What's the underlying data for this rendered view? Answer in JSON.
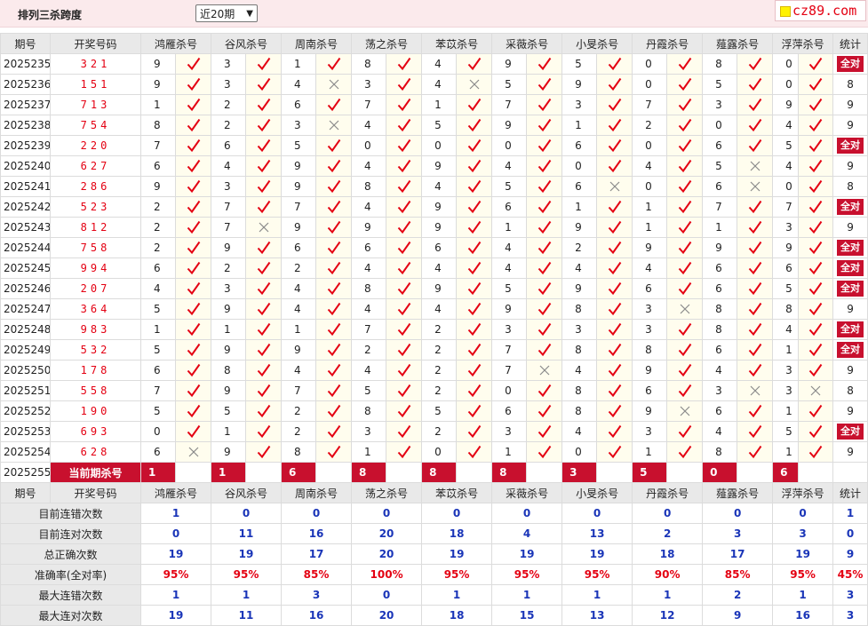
{
  "title": "排列三杀跨度",
  "select": {
    "value": "近20期"
  },
  "logo": {
    "text": "cz89.com"
  },
  "headers": [
    "期号",
    "开奖号码",
    "鸿雁杀号",
    "谷风杀号",
    "周南杀号",
    "荡之杀号",
    "苯苡杀号",
    "采薇杀号",
    "小旻杀号",
    "丹霞杀号",
    "薤露杀号",
    "浮萍杀号",
    "统计"
  ],
  "rows": [
    {
      "period": "2025235",
      "code": "321",
      "v": [
        9,
        3,
        1,
        8,
        4,
        9,
        5,
        0,
        8,
        0
      ],
      "ok": [
        1,
        1,
        1,
        1,
        1,
        1,
        1,
        1,
        1,
        1
      ],
      "total": "全对"
    },
    {
      "period": "2025236",
      "code": "151",
      "v": [
        9,
        3,
        4,
        3,
        4,
        5,
        9,
        0,
        5,
        0
      ],
      "ok": [
        1,
        1,
        0,
        1,
        0,
        1,
        1,
        1,
        1,
        1
      ],
      "total": "8"
    },
    {
      "period": "2025237",
      "code": "713",
      "v": [
        1,
        2,
        6,
        7,
        1,
        7,
        3,
        7,
        3,
        9
      ],
      "ok": [
        1,
        1,
        1,
        1,
        1,
        1,
        1,
        1,
        1,
        1
      ],
      "total": "9"
    },
    {
      "period": "2025238",
      "code": "754",
      "v": [
        8,
        2,
        3,
        4,
        5,
        9,
        1,
        2,
        0,
        4
      ],
      "ok": [
        1,
        1,
        0,
        1,
        1,
        1,
        1,
        1,
        1,
        1
      ],
      "total": "9"
    },
    {
      "period": "2025239",
      "code": "220",
      "v": [
        7,
        6,
        5,
        0,
        0,
        0,
        6,
        0,
        6,
        5
      ],
      "ok": [
        1,
        1,
        1,
        1,
        1,
        1,
        1,
        1,
        1,
        1
      ],
      "total": "全对"
    },
    {
      "period": "2025240",
      "code": "627",
      "v": [
        6,
        4,
        9,
        4,
        9,
        4,
        0,
        4,
        5,
        4
      ],
      "ok": [
        1,
        1,
        1,
        1,
        1,
        1,
        1,
        1,
        0,
        1
      ],
      "total": "9"
    },
    {
      "period": "2025241",
      "code": "286",
      "v": [
        9,
        3,
        9,
        8,
        4,
        5,
        6,
        0,
        6,
        0
      ],
      "ok": [
        1,
        1,
        1,
        1,
        1,
        1,
        0,
        1,
        0,
        1
      ],
      "total": "8"
    },
    {
      "period": "2025242",
      "code": "523",
      "v": [
        2,
        7,
        7,
        4,
        9,
        6,
        1,
        1,
        7,
        7
      ],
      "ok": [
        1,
        1,
        1,
        1,
        1,
        1,
        1,
        1,
        1,
        1
      ],
      "total": "全对"
    },
    {
      "period": "2025243",
      "code": "812",
      "v": [
        2,
        7,
        9,
        9,
        9,
        1,
        9,
        1,
        1,
        3
      ],
      "ok": [
        1,
        0,
        1,
        1,
        1,
        1,
        1,
        1,
        1,
        1
      ],
      "total": "9"
    },
    {
      "period": "2025244",
      "code": "758",
      "v": [
        2,
        9,
        6,
        6,
        6,
        4,
        2,
        9,
        9,
        9
      ],
      "ok": [
        1,
        1,
        1,
        1,
        1,
        1,
        1,
        1,
        1,
        1
      ],
      "total": "全对"
    },
    {
      "period": "2025245",
      "code": "994",
      "v": [
        6,
        2,
        2,
        4,
        4,
        4,
        4,
        4,
        6,
        6
      ],
      "ok": [
        1,
        1,
        1,
        1,
        1,
        1,
        1,
        1,
        1,
        1
      ],
      "total": "全对"
    },
    {
      "period": "2025246",
      "code": "207",
      "v": [
        4,
        3,
        4,
        8,
        9,
        5,
        9,
        6,
        6,
        5
      ],
      "ok": [
        1,
        1,
        1,
        1,
        1,
        1,
        1,
        1,
        1,
        1
      ],
      "total": "全对"
    },
    {
      "period": "2025247",
      "code": "364",
      "v": [
        5,
        9,
        4,
        4,
        4,
        9,
        8,
        3,
        8,
        8
      ],
      "ok": [
        1,
        1,
        1,
        1,
        1,
        1,
        1,
        0,
        1,
        1
      ],
      "total": "9"
    },
    {
      "period": "2025248",
      "code": "983",
      "v": [
        1,
        1,
        1,
        7,
        2,
        3,
        3,
        3,
        8,
        4
      ],
      "ok": [
        1,
        1,
        1,
        1,
        1,
        1,
        1,
        1,
        1,
        1
      ],
      "total": "全对"
    },
    {
      "period": "2025249",
      "code": "532",
      "v": [
        5,
        9,
        9,
        2,
        2,
        7,
        8,
        8,
        6,
        1
      ],
      "ok": [
        1,
        1,
        1,
        1,
        1,
        1,
        1,
        1,
        1,
        1
      ],
      "total": "全对"
    },
    {
      "period": "2025250",
      "code": "178",
      "v": [
        6,
        8,
        4,
        4,
        2,
        7,
        4,
        9,
        4,
        3
      ],
      "ok": [
        1,
        1,
        1,
        1,
        1,
        0,
        1,
        1,
        1,
        1
      ],
      "total": "9"
    },
    {
      "period": "2025251",
      "code": "558",
      "v": [
        7,
        9,
        7,
        5,
        2,
        0,
        8,
        6,
        3,
        3
      ],
      "ok": [
        1,
        1,
        1,
        1,
        1,
        1,
        1,
        1,
        0,
        0
      ],
      "total": "8"
    },
    {
      "period": "2025252",
      "code": "190",
      "v": [
        5,
        5,
        2,
        8,
        5,
        6,
        8,
        9,
        6,
        1
      ],
      "ok": [
        1,
        1,
        1,
        1,
        1,
        1,
        1,
        0,
        1,
        1
      ],
      "total": "9"
    },
    {
      "period": "2025253",
      "code": "693",
      "v": [
        0,
        1,
        2,
        3,
        2,
        3,
        4,
        3,
        4,
        5
      ],
      "ok": [
        1,
        1,
        1,
        1,
        1,
        1,
        1,
        1,
        1,
        1
      ],
      "total": "全对"
    },
    {
      "period": "2025254",
      "code": "628",
      "v": [
        6,
        9,
        8,
        1,
        0,
        1,
        0,
        1,
        8,
        1
      ],
      "ok": [
        0,
        1,
        1,
        1,
        1,
        1,
        1,
        1,
        1,
        1
      ],
      "total": "9"
    }
  ],
  "current": {
    "period": "2025255",
    "label": "当前期杀号",
    "values": [
      "1",
      "1",
      "6",
      "8",
      "8",
      "8",
      "3",
      "5",
      "0",
      "6"
    ]
  },
  "summary": [
    {
      "label": "目前连错次数",
      "values": [
        "1",
        "0",
        "0",
        "0",
        "0",
        "0",
        "0",
        "0",
        "0",
        "0",
        "1"
      ],
      "color": "blue"
    },
    {
      "label": "目前连对次数",
      "values": [
        "0",
        "11",
        "16",
        "20",
        "18",
        "4",
        "13",
        "2",
        "3",
        "3",
        "0"
      ],
      "color": "blue"
    },
    {
      "label": "总正确次数",
      "values": [
        "19",
        "19",
        "17",
        "20",
        "19",
        "19",
        "19",
        "18",
        "17",
        "19",
        "9"
      ],
      "color": "blue"
    },
    {
      "label": "准确率(全对率)",
      "values": [
        "95%",
        "95%",
        "85%",
        "100%",
        "95%",
        "95%",
        "95%",
        "90%",
        "85%",
        "95%",
        "45%"
      ],
      "color": "red"
    },
    {
      "label": "最大连错次数",
      "values": [
        "1",
        "1",
        "3",
        "0",
        "1",
        "1",
        "1",
        "1",
        "2",
        "1",
        "3"
      ],
      "color": "blue"
    },
    {
      "label": "最大连对次数",
      "values": [
        "19",
        "11",
        "16",
        "20",
        "18",
        "15",
        "13",
        "12",
        "9",
        "16",
        "3"
      ],
      "color": "blue"
    }
  ],
  "colors": {
    "accent": "#c8102e",
    "check": "#e40012",
    "cross": "#8a8a8a",
    "blue": "#1a35b8",
    "header_bg": "#e9e9e9",
    "mark_bg": "#fffdee"
  }
}
